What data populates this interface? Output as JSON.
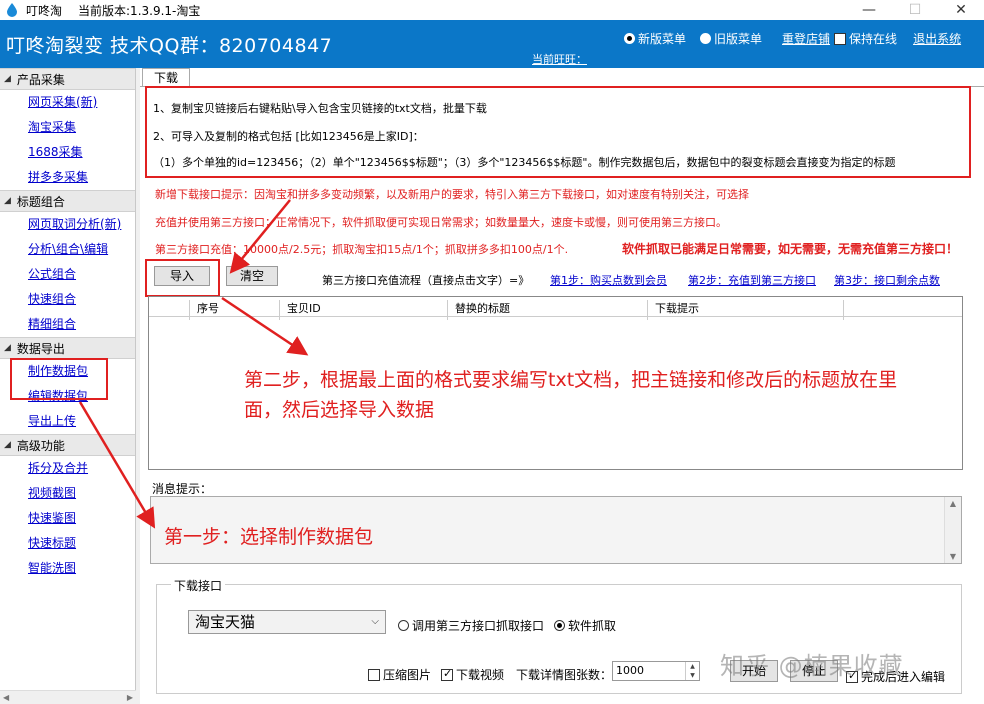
{
  "window": {
    "app_name": "叮咚淘",
    "version_label": "当前版本:1.3.9.1-淘宝",
    "controls": [
      "—",
      "☐",
      "✕"
    ]
  },
  "header": {
    "brand": "叮咚淘裂变   技术QQ群：820704847",
    "new_menu": "新版菜单",
    "old_menu": "旧版菜单",
    "relogin": "重登店铺",
    "keep_online": "保持在线",
    "logout": "退出系统",
    "wangwang": "当前旺旺："
  },
  "sidebar": {
    "sections": [
      {
        "title": "产品采集",
        "items": [
          "网页采集(新)",
          "淘宝采集",
          "1688采集",
          "拼多多采集"
        ]
      },
      {
        "title": "标题组合",
        "items": [
          "网页取词分析(新)",
          "分析\\组合\\编辑",
          "公式组合",
          "快速组合",
          "精细组合"
        ]
      },
      {
        "title": "数据导出",
        "items": [
          "制作数据包",
          "编辑数据包",
          "导出上传"
        ]
      },
      {
        "title": "高级功能",
        "items": [
          "拆分及合并",
          "视频截图",
          "快速鉴图",
          "快速标题",
          "智能洗图"
        ]
      }
    ]
  },
  "main": {
    "tab": "下载",
    "instructions": [
      "1、复制宝贝链接后右键粘贴\\导入包含宝贝链接的txt文档，批量下载",
      "2、可导入及复制的格式包括  [比如123456是上家ID]：",
      "（1）多个单独的id=123456；（2）单个\"123456$$标题\"；（3）多个\"123456$$标题\"。制作完数据包后，数据包中的裂变标题会直接变为指定的标题"
    ],
    "notice1": "新增下载接口提示：因淘宝和拼多多变动频繁，以及新用户的要求，特引入第三方下载接口，如对速度有特别关注，可选择",
    "notice2": "充值并使用第三方接口；正常情况下，软件抓取便可实现日常需求；如数量量大，速度卡或慢，则可使用第三方接口。",
    "notice3": "第三方接口充值：10000点/2.5元；抓取淘宝扣15点/1个；抓取拼多多扣100点/1个.",
    "notice4": "软件抓取已能满足日常需要，如无需要，无需充值第三方接口！",
    "import_btn": "导入",
    "clear_btn": "清空",
    "flow_label": "第三方接口充值流程（直接点击文字）=》",
    "step1": "第1步：购买点数到会员",
    "step2": "第2步：充值到第三方接口",
    "step3": "第3步：接口剩余点数",
    "columns": [
      "序号",
      "宝贝ID",
      "替换的标题",
      "下载提示"
    ],
    "annotation_step2": "第二步，根据最上面的格式要求编写txt文档，把主链接和修改后的标题放在里面，然后选择导入数据",
    "msg_label": "消息提示：",
    "annotation_step1": "第一步：选择制作数据包",
    "download_group": "下载接口",
    "source_select": "淘宝天猫",
    "opt_third": "调用第三方接口抓取接口",
    "opt_soft": "软件抓取",
    "compress": "压缩图片",
    "download_video": "下载视频",
    "detail_count_label": "下载详情图张数：",
    "detail_count": "1000",
    "start_btn": "开始",
    "stop_btn": "停止",
    "after_edit": "完成后进入编辑",
    "watermark": "知乎 @楠果收藏"
  }
}
